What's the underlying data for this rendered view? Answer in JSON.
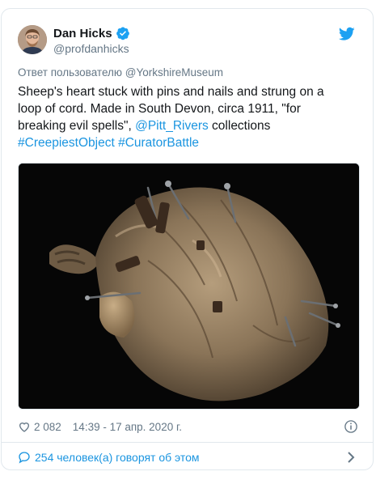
{
  "tweet": {
    "display_name": "Dan Hicks",
    "handle": "@profdanhicks",
    "reply_prefix": "Ответ пользователю ",
    "reply_to": "@YorkshireMuseum",
    "text_part1": "Sheep's heart stuck with pins and nails and strung on a loop of cord. Made in South Devon, circa 1911, \"for breaking evil spells\", ",
    "mention": "@Pitt_Rivers",
    "text_part2": " collections ",
    "hashtag1": "#CreepiestObject",
    "hashtag2": "#CuratorBattle",
    "likes": "2 082",
    "timestamp": "14:39 - 17 апр. 2020 г.",
    "conversation": "254 человек(а) говорят об этом"
  },
  "icons": {
    "verified": "verified-badge-icon",
    "bird": "twitter-bird-icon",
    "like": "heart-icon",
    "info": "info-icon",
    "conversation": "speech-bubble-icon",
    "chevron": "chevron-right-icon"
  },
  "colors": {
    "link": "#1b95e0",
    "text": "#14171a",
    "secondary": "#657786",
    "border": "#e1e8ed"
  }
}
